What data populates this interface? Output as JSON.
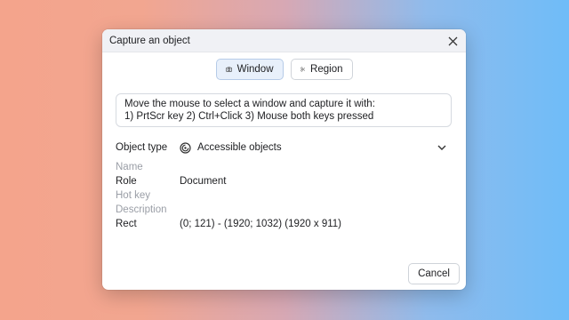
{
  "dialog": {
    "title": "Capture an object",
    "close_icon": "close-icon"
  },
  "modes": {
    "window_label": "Window",
    "window_icon": "camera-icon",
    "region_label": "Region",
    "region_icon": "scissors-icon",
    "active": "Window"
  },
  "instructions": {
    "line1": "Move the mouse to select a window and capture it with:",
    "line2": "1) PrtScr key  2) Ctrl+Click  3) Mouse both keys pressed"
  },
  "object_type": {
    "label": "Object type",
    "value": "Accessible objects",
    "icon": "accessibility-icon"
  },
  "properties": [
    {
      "key": "Name",
      "value": "",
      "muted": true
    },
    {
      "key": "Role",
      "value": "Document",
      "muted": false
    },
    {
      "key": "Hot key",
      "value": "",
      "muted": true
    },
    {
      "key": "Description",
      "value": "",
      "muted": true
    },
    {
      "key": "Rect",
      "value": "(0; 121) - (1920; 1032) (1920 x 911)",
      "muted": false
    }
  ],
  "footer": {
    "cancel_label": "Cancel"
  },
  "colors": {
    "accent_bg": "#e8f0fb",
    "accent_border": "#b6cbe8",
    "muted_text": "#9a9ea6"
  }
}
